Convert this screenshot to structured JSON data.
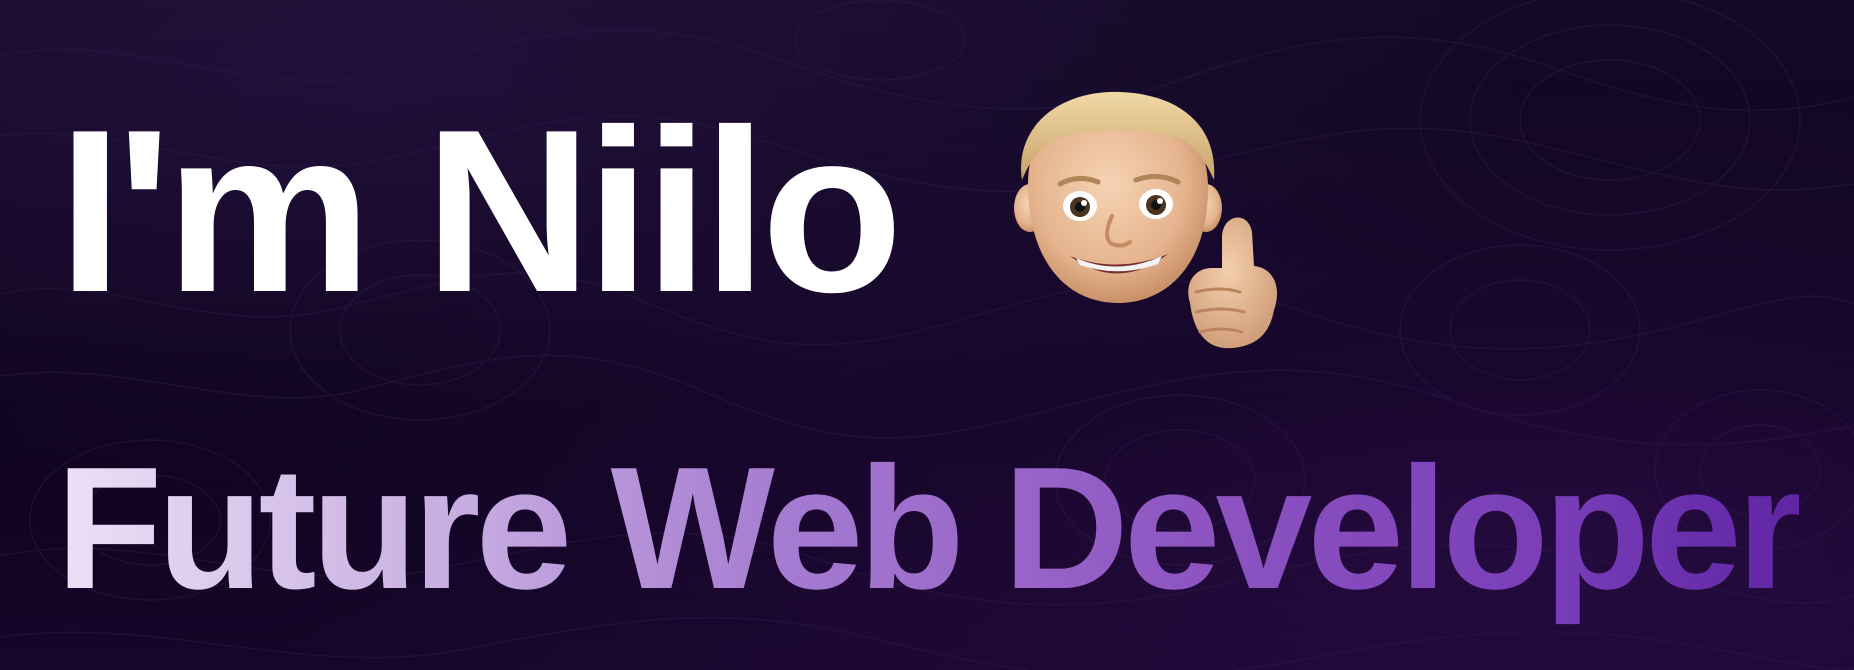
{
  "hero": {
    "greeting": "I'm Niilo",
    "subtitle": "Future Web Developer",
    "avatar_icon": "memoji-thumbs-up-icon"
  },
  "colors": {
    "background": "#100422",
    "headline": "#ffffff",
    "subtitle_gradient_start": "#ece0f6",
    "subtitle_gradient_end": "#5f25a4"
  }
}
